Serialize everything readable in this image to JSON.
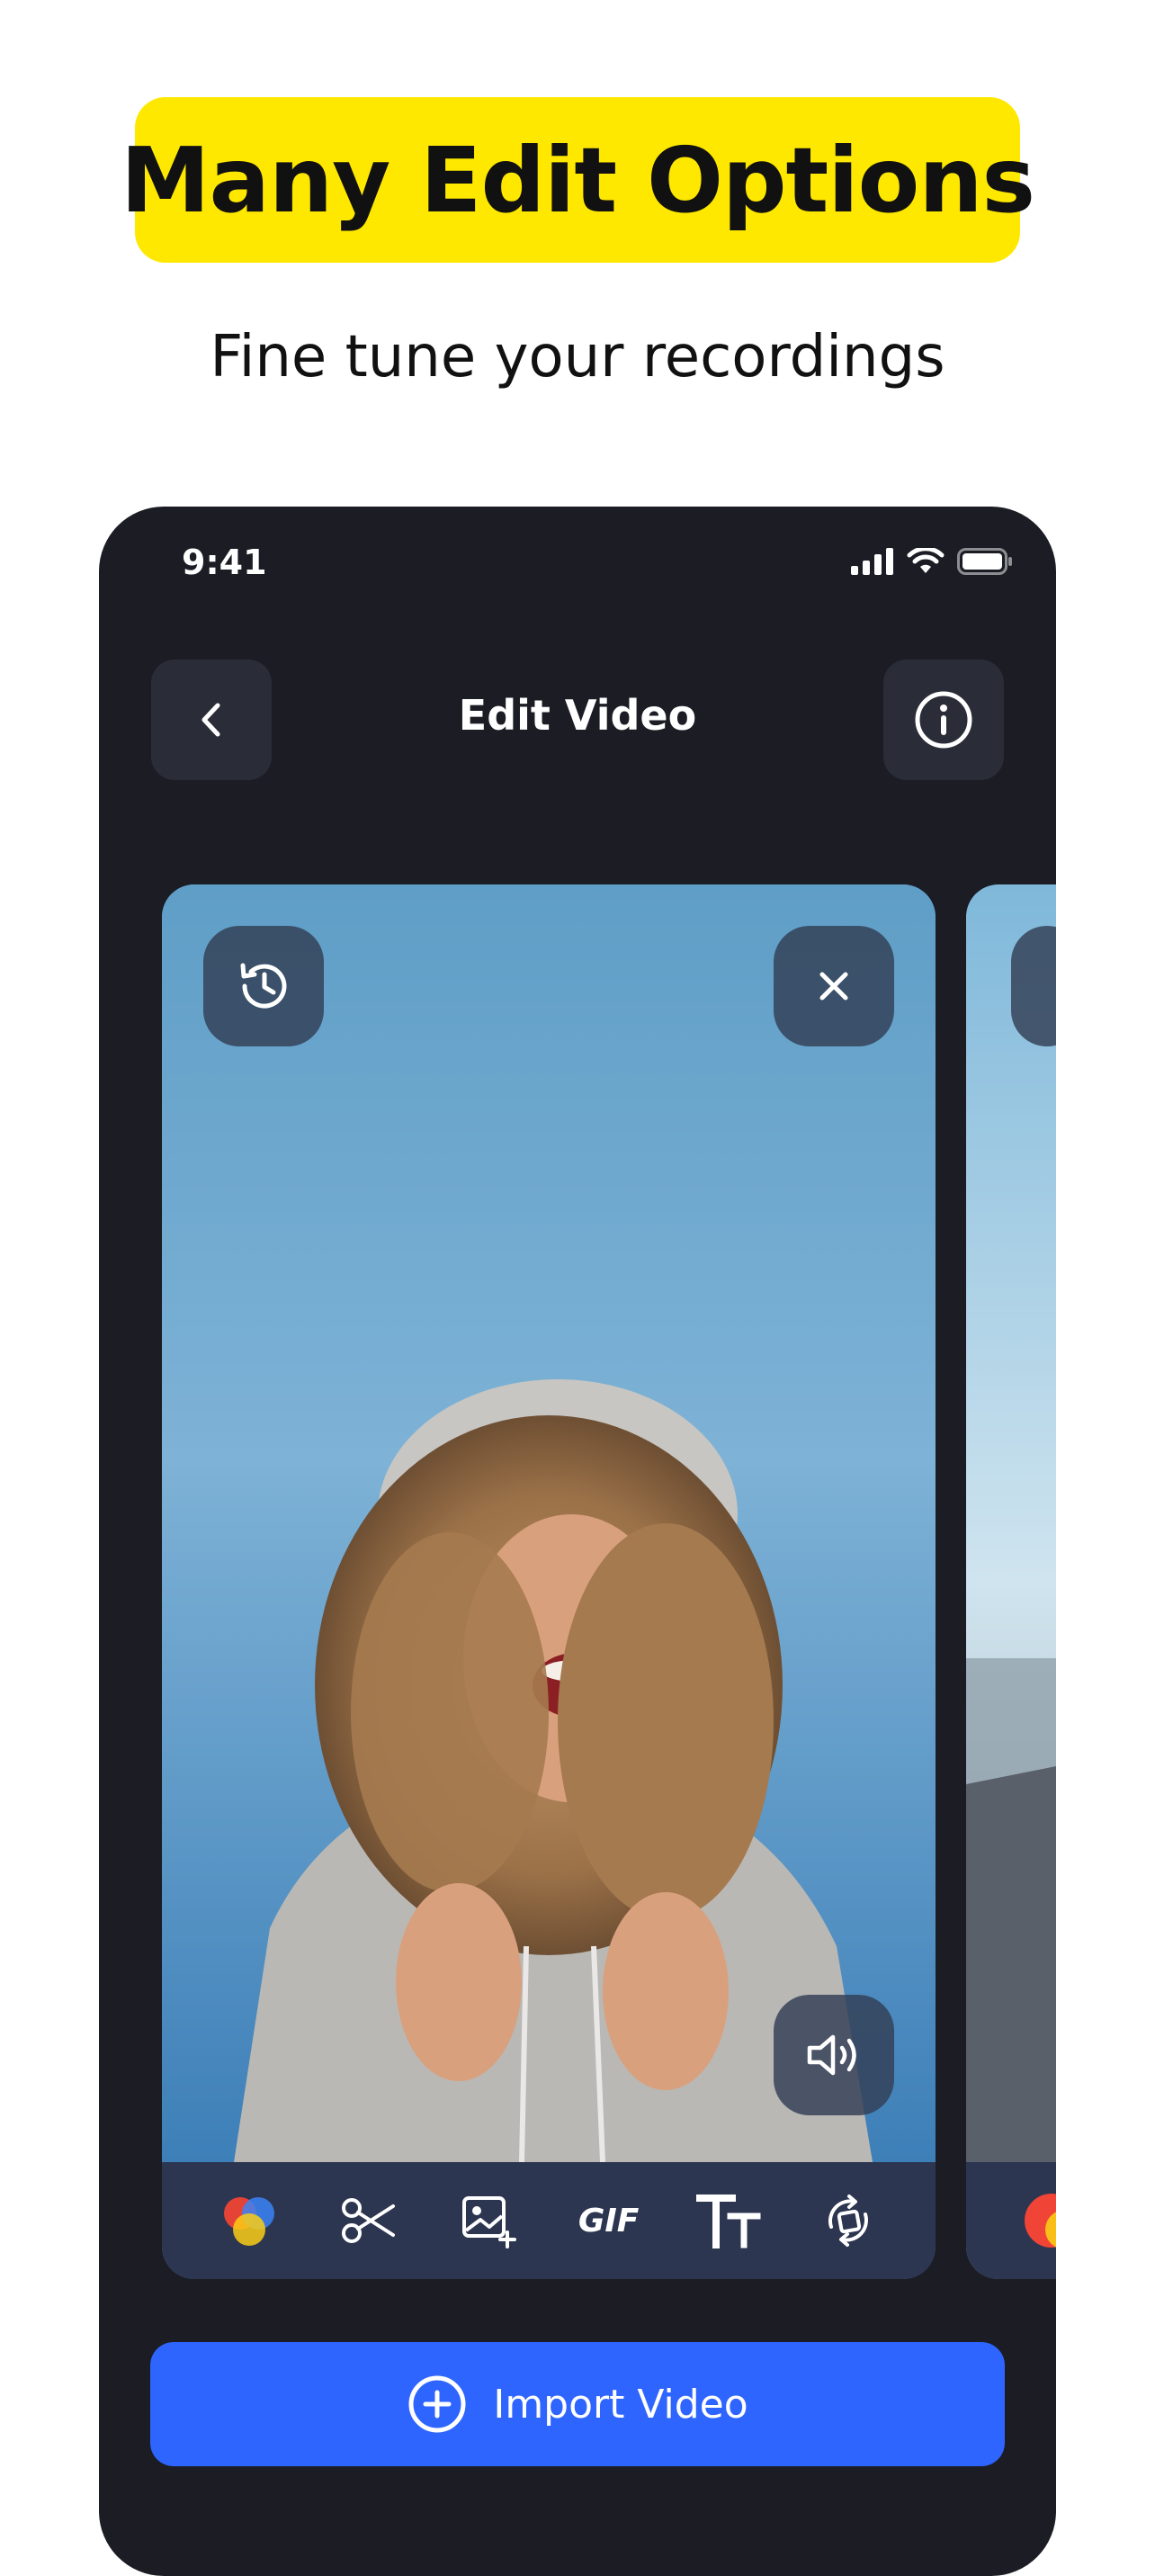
{
  "headline": {
    "text": "Many Edit Options",
    "background": "#FFE800"
  },
  "subtitle": "Fine tune your recordings",
  "status_bar": {
    "time": "9:41"
  },
  "nav": {
    "title": "Edit Video",
    "back_icon": "chevron-left-icon",
    "info_icon": "info-icon"
  },
  "card": {
    "restore_icon": "history-icon",
    "close_icon": "close-icon",
    "volume_icon": "volume-icon",
    "toolbar": [
      {
        "name": "color-filter-icon"
      },
      {
        "name": "scissors-icon"
      },
      {
        "name": "add-image-icon"
      },
      {
        "name": "gif-icon",
        "label": "GIF"
      },
      {
        "name": "text-size-icon"
      },
      {
        "name": "rotate-icon"
      }
    ]
  },
  "import_button": {
    "label": "Import Video",
    "icon": "plus-circle-icon",
    "color": "#2F65FF"
  }
}
